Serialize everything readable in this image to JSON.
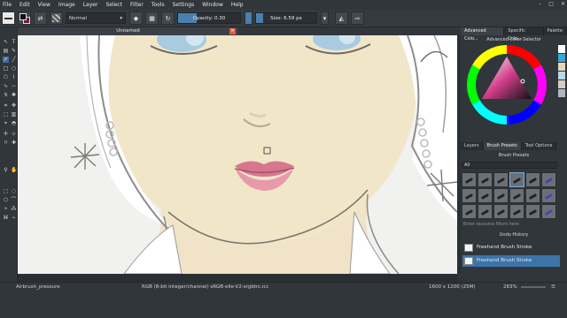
{
  "menu": [
    "File",
    "Edit",
    "View",
    "Image",
    "Layer",
    "Select",
    "Filter",
    "Tools",
    "Settings",
    "Window",
    "Help"
  ],
  "window_controls": [
    "–",
    "□",
    "✕"
  ],
  "toolbar": {
    "blend_mode": "Normal",
    "opacity_label": "Opacity:",
    "opacity_value": "0.30",
    "opacity_fraction": 0.3,
    "size_label": "Size:",
    "size_value": "6.59 px",
    "size_fraction": 0.12
  },
  "document": {
    "tab_title": "Unnamed",
    "close": "✕"
  },
  "dock": {
    "top_tabs": [
      "Advanced Colo...",
      "Specific Colo...",
      "Palette"
    ],
    "color_selector_title": "Advanced Color Selector",
    "panel_tabs": [
      "Layers",
      "Brush Presets",
      "Tool Options"
    ],
    "brush_presets_title": "Brush Presets",
    "tag_filter": "All",
    "search_placeholder": "Enter resource filters here",
    "undo_title": "Undo History",
    "history": [
      "Freehand Brush Stroke",
      "Freehand Brush Stroke"
    ]
  },
  "status": {
    "tool": "Airbrush_pressure",
    "color_space": "RGB (8-bit integer/channel)  sRGB-elle-V2-srgbtrc.icc",
    "dimensions": "1600 x 1200 (25M)",
    "zoom": "283%"
  },
  "colors": {
    "accent": "#4a7fb0",
    "foreground": "#111111",
    "background": "#6e1a3a"
  }
}
